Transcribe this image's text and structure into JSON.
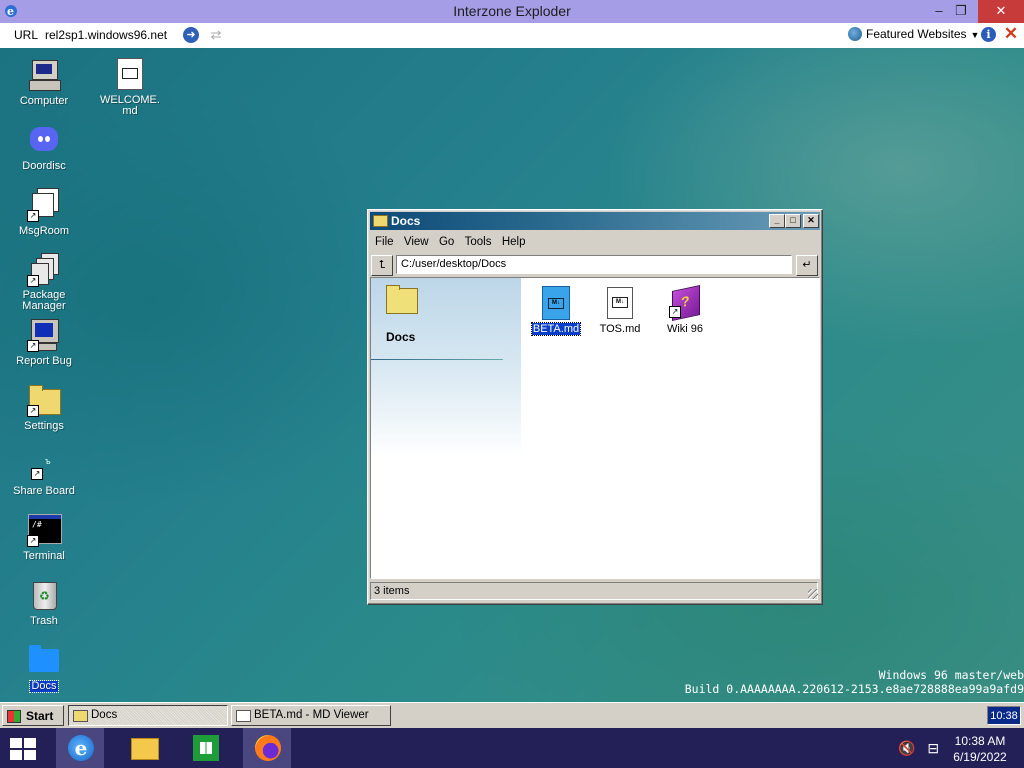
{
  "browser": {
    "title": "Interzone Exploder",
    "minimize": "–",
    "restore": "❐",
    "close": "✕",
    "url_label": "URL",
    "url": "rel2sp1.windows96.net",
    "featured_label": "Featured Websites"
  },
  "desktop": {
    "icons": [
      {
        "label": "Computer"
      },
      {
        "label": "WELCOME.md"
      },
      {
        "label": "Doordisc"
      },
      {
        "label": "MsgRoom"
      },
      {
        "label": "Package Manager"
      },
      {
        "label": "Report Bug"
      },
      {
        "label": "Settings"
      },
      {
        "label": "Share Board"
      },
      {
        "label": "Terminal"
      },
      {
        "label": "Trash"
      },
      {
        "label": "Docs"
      }
    ],
    "build_line1": "Windows 96 master/web",
    "build_line2": "Build 0.AAAAAAAA.220612-2153.e8ae728888ea99a9afd9"
  },
  "explorer": {
    "title": "Docs",
    "menu": [
      "File",
      "View",
      "Go",
      "Tools",
      "Help"
    ],
    "up_glyph": "⮤",
    "address": "C:/user/desktop/Docs",
    "go_glyph": "↵",
    "sidebar_title": "Docs",
    "files": [
      {
        "label": "BETA.md",
        "selected": true
      },
      {
        "label": "TOS.md"
      },
      {
        "label": "Wiki 96"
      }
    ],
    "status": "3 items"
  },
  "taskbar96": {
    "start": "Start",
    "tasks": [
      {
        "label": "Docs",
        "active": true
      },
      {
        "label": "BETA.md - MD Viewer",
        "active": false
      }
    ],
    "clock": "10:38"
  },
  "host_taskbar": {
    "time": "10:38 AM",
    "date": "6/19/2022"
  },
  "colors": {
    "browser_title_bg": "#a59ee6",
    "explorer_title": "#0e4b78",
    "selection": "#0a3ec8",
    "host_taskbar": "#231f57"
  }
}
